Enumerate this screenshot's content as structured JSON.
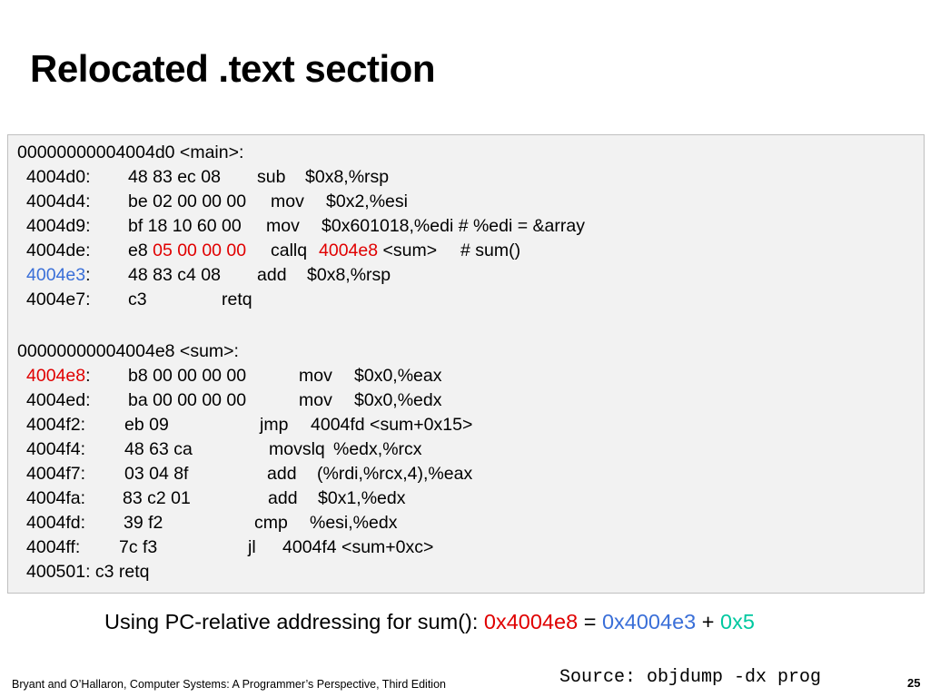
{
  "slide": {
    "title": "Relocated .text section",
    "caption": {
      "text": "Using PC-relative addressing for sum():",
      "target": "0x4004e8",
      "equals": "=",
      "pc": "0x4004e3",
      "plus": "+",
      "offset": "0x5"
    },
    "source": "Source: objdump -dx prog",
    "credit": "Bryant and O’Hallaron, Computer Systems: A Programmer’s Perspective, Third Edition",
    "page_number": "25"
  },
  "code": {
    "main_header": "00000000004004d0 <main>:",
    "main": [
      {
        "addr": "4004d0:",
        "bytes": "48 83 ec 08",
        "mnem": "sub",
        "ops": "$0x8,%rsp"
      },
      {
        "addr": "4004d4:",
        "bytes": "be 02 00 00 00",
        "mnem": "mov",
        "ops": "$0x2,%esi"
      },
      {
        "addr": "4004d9:",
        "bytes": "bf 18 10 60 00",
        "mnem": "mov",
        "ops": "$0x601018,%edi  # %edi = &array"
      },
      {
        "addr": "4004de:",
        "bytes_prefix": "e8 ",
        "bytes_hl": "05 00 00 00",
        "mnem": "callq",
        "target_hl": "4004e8",
        "ops_rest": " <sum>",
        "comment": "# sum()"
      },
      {
        "addr_hl": "4004e3",
        "addr_colon": ":",
        "bytes": "48 83 c4 08",
        "mnem": "add",
        "ops": "$0x8,%rsp"
      },
      {
        "addr": "4004e7:",
        "bytes": "c3",
        "mnem": "retq"
      }
    ],
    "sum_header": "00000000004004e8 <sum>:",
    "sum": [
      {
        "addr_hl": "4004e8",
        "addr_colon": ":",
        "bytes": "b8 00 00 00 00",
        "mnem": "mov",
        "ops": "$0x0,%eax"
      },
      {
        "addr": "4004ed:",
        "bytes": "ba 00 00 00 00",
        "mnem": "mov",
        "ops": "$0x0,%edx"
      },
      {
        "addr": "4004f2:",
        "bytes": "eb 09",
        "mnem": "jmp",
        "ops": "4004fd <sum+0x15>"
      },
      {
        "addr": "4004f4:",
        "bytes": "48 63 ca",
        "mnem": "movslq",
        "ops": "%edx,%rcx"
      },
      {
        "addr": "4004f7:",
        "bytes": "03 04 8f",
        "mnem": "add",
        "ops": "(%rdi,%rcx,4),%eax"
      },
      {
        "addr": "4004fa:",
        "bytes": "83 c2 01",
        "mnem": "add",
        "ops": "$0x1,%edx"
      },
      {
        "addr": "4004fd:",
        "bytes": "39 f2",
        "mnem": "cmp",
        "ops": "%esi,%edx"
      },
      {
        "addr": "4004ff:",
        "bytes": "7c f3",
        "mnem": "jl",
        "ops": "4004f4 <sum+0xc>"
      },
      {
        "text": "400501: c3 retq"
      }
    ]
  },
  "colors": {
    "highlight_red": "#e00000",
    "highlight_blue": "#3a6fd8",
    "highlight_green": "#00c8a0",
    "code_background": "#f2f2f2"
  }
}
